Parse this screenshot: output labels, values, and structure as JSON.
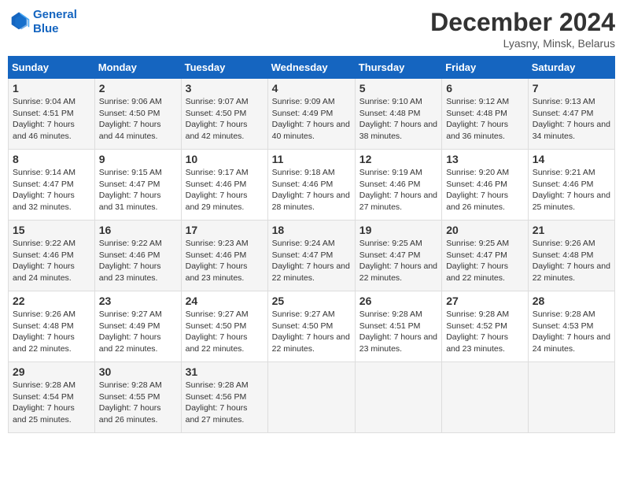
{
  "logo": {
    "line1": "General",
    "line2": "Blue"
  },
  "title": "December 2024",
  "subtitle": "Lyasny, Minsk, Belarus",
  "weekdays": [
    "Sunday",
    "Monday",
    "Tuesday",
    "Wednesday",
    "Thursday",
    "Friday",
    "Saturday"
  ],
  "weeks": [
    [
      {
        "day": "1",
        "sunrise": "9:04 AM",
        "sunset": "4:51 PM",
        "daylight": "7 hours and 46 minutes."
      },
      {
        "day": "2",
        "sunrise": "9:06 AM",
        "sunset": "4:50 PM",
        "daylight": "7 hours and 44 minutes."
      },
      {
        "day": "3",
        "sunrise": "9:07 AM",
        "sunset": "4:50 PM",
        "daylight": "7 hours and 42 minutes."
      },
      {
        "day": "4",
        "sunrise": "9:09 AM",
        "sunset": "4:49 PM",
        "daylight": "7 hours and 40 minutes."
      },
      {
        "day": "5",
        "sunrise": "9:10 AM",
        "sunset": "4:48 PM",
        "daylight": "7 hours and 38 minutes."
      },
      {
        "day": "6",
        "sunrise": "9:12 AM",
        "sunset": "4:48 PM",
        "daylight": "7 hours and 36 minutes."
      },
      {
        "day": "7",
        "sunrise": "9:13 AM",
        "sunset": "4:47 PM",
        "daylight": "7 hours and 34 minutes."
      }
    ],
    [
      {
        "day": "8",
        "sunrise": "9:14 AM",
        "sunset": "4:47 PM",
        "daylight": "7 hours and 32 minutes."
      },
      {
        "day": "9",
        "sunrise": "9:15 AM",
        "sunset": "4:47 PM",
        "daylight": "7 hours and 31 minutes."
      },
      {
        "day": "10",
        "sunrise": "9:17 AM",
        "sunset": "4:46 PM",
        "daylight": "7 hours and 29 minutes."
      },
      {
        "day": "11",
        "sunrise": "9:18 AM",
        "sunset": "4:46 PM",
        "daylight": "7 hours and 28 minutes."
      },
      {
        "day": "12",
        "sunrise": "9:19 AM",
        "sunset": "4:46 PM",
        "daylight": "7 hours and 27 minutes."
      },
      {
        "day": "13",
        "sunrise": "9:20 AM",
        "sunset": "4:46 PM",
        "daylight": "7 hours and 26 minutes."
      },
      {
        "day": "14",
        "sunrise": "9:21 AM",
        "sunset": "4:46 PM",
        "daylight": "7 hours and 25 minutes."
      }
    ],
    [
      {
        "day": "15",
        "sunrise": "9:22 AM",
        "sunset": "4:46 PM",
        "daylight": "7 hours and 24 minutes."
      },
      {
        "day": "16",
        "sunrise": "9:22 AM",
        "sunset": "4:46 PM",
        "daylight": "7 hours and 23 minutes."
      },
      {
        "day": "17",
        "sunrise": "9:23 AM",
        "sunset": "4:46 PM",
        "daylight": "7 hours and 23 minutes."
      },
      {
        "day": "18",
        "sunrise": "9:24 AM",
        "sunset": "4:47 PM",
        "daylight": "7 hours and 22 minutes."
      },
      {
        "day": "19",
        "sunrise": "9:25 AM",
        "sunset": "4:47 PM",
        "daylight": "7 hours and 22 minutes."
      },
      {
        "day": "20",
        "sunrise": "9:25 AM",
        "sunset": "4:47 PM",
        "daylight": "7 hours and 22 minutes."
      },
      {
        "day": "21",
        "sunrise": "9:26 AM",
        "sunset": "4:48 PM",
        "daylight": "7 hours and 22 minutes."
      }
    ],
    [
      {
        "day": "22",
        "sunrise": "9:26 AM",
        "sunset": "4:48 PM",
        "daylight": "7 hours and 22 minutes."
      },
      {
        "day": "23",
        "sunrise": "9:27 AM",
        "sunset": "4:49 PM",
        "daylight": "7 hours and 22 minutes."
      },
      {
        "day": "24",
        "sunrise": "9:27 AM",
        "sunset": "4:50 PM",
        "daylight": "7 hours and 22 minutes."
      },
      {
        "day": "25",
        "sunrise": "9:27 AM",
        "sunset": "4:50 PM",
        "daylight": "7 hours and 22 minutes."
      },
      {
        "day": "26",
        "sunrise": "9:28 AM",
        "sunset": "4:51 PM",
        "daylight": "7 hours and 23 minutes."
      },
      {
        "day": "27",
        "sunrise": "9:28 AM",
        "sunset": "4:52 PM",
        "daylight": "7 hours and 23 minutes."
      },
      {
        "day": "28",
        "sunrise": "9:28 AM",
        "sunset": "4:53 PM",
        "daylight": "7 hours and 24 minutes."
      }
    ],
    [
      {
        "day": "29",
        "sunrise": "9:28 AM",
        "sunset": "4:54 PM",
        "daylight": "7 hours and 25 minutes."
      },
      {
        "day": "30",
        "sunrise": "9:28 AM",
        "sunset": "4:55 PM",
        "daylight": "7 hours and 26 minutes."
      },
      {
        "day": "31",
        "sunrise": "9:28 AM",
        "sunset": "4:56 PM",
        "daylight": "7 hours and 27 minutes."
      },
      null,
      null,
      null,
      null
    ]
  ]
}
